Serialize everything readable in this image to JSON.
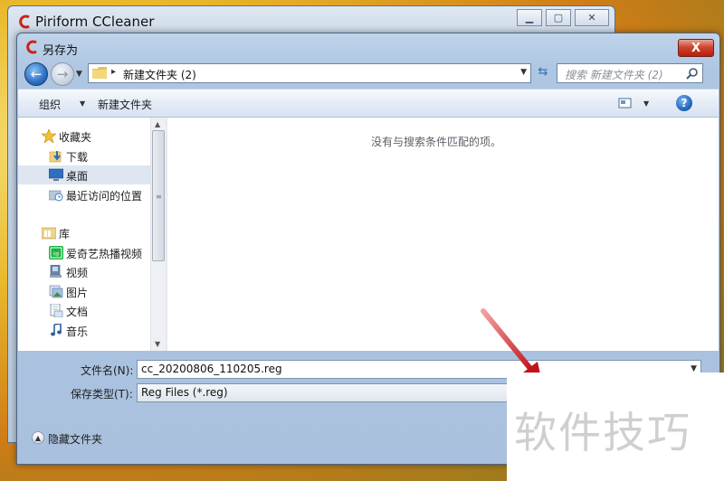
{
  "back_window": {
    "title": "Piriform CCleaner"
  },
  "dialog": {
    "title": "另存为",
    "close_label": "X"
  },
  "nav": {
    "path_sep": "▸",
    "current_folder": "新建文件夹 (2)",
    "search_placeholder": "搜索 新建文件夹 (2)"
  },
  "toolbar": {
    "organize_label": "组织",
    "new_folder_label": "新建文件夹",
    "help_label": "?"
  },
  "sidebar": {
    "favorites": "收藏夹",
    "downloads": "下载",
    "desktop": "桌面",
    "recent": "最近访问的位置",
    "libraries": "库",
    "iqiyi": "爱奇艺热播视频",
    "iqiyi_badge": "iqi",
    "videos": "视频",
    "pictures": "图片",
    "documents": "文档",
    "music": "音乐"
  },
  "content": {
    "empty_message": "没有与搜索条件匹配的项。"
  },
  "form": {
    "filename_label": "文件名(N):",
    "filename_value": "cc_20200806_110205.reg",
    "filetype_label": "保存类型(T):",
    "filetype_value": "Reg Files (*.reg)"
  },
  "footer": {
    "hide_folders_label": "隐藏文件夹"
  },
  "watermark": {
    "text": "软件技巧"
  },
  "colors": {
    "accent": "#2b6fc5",
    "close_red": "#cf4530",
    "arrow_red": "#c0141b"
  }
}
